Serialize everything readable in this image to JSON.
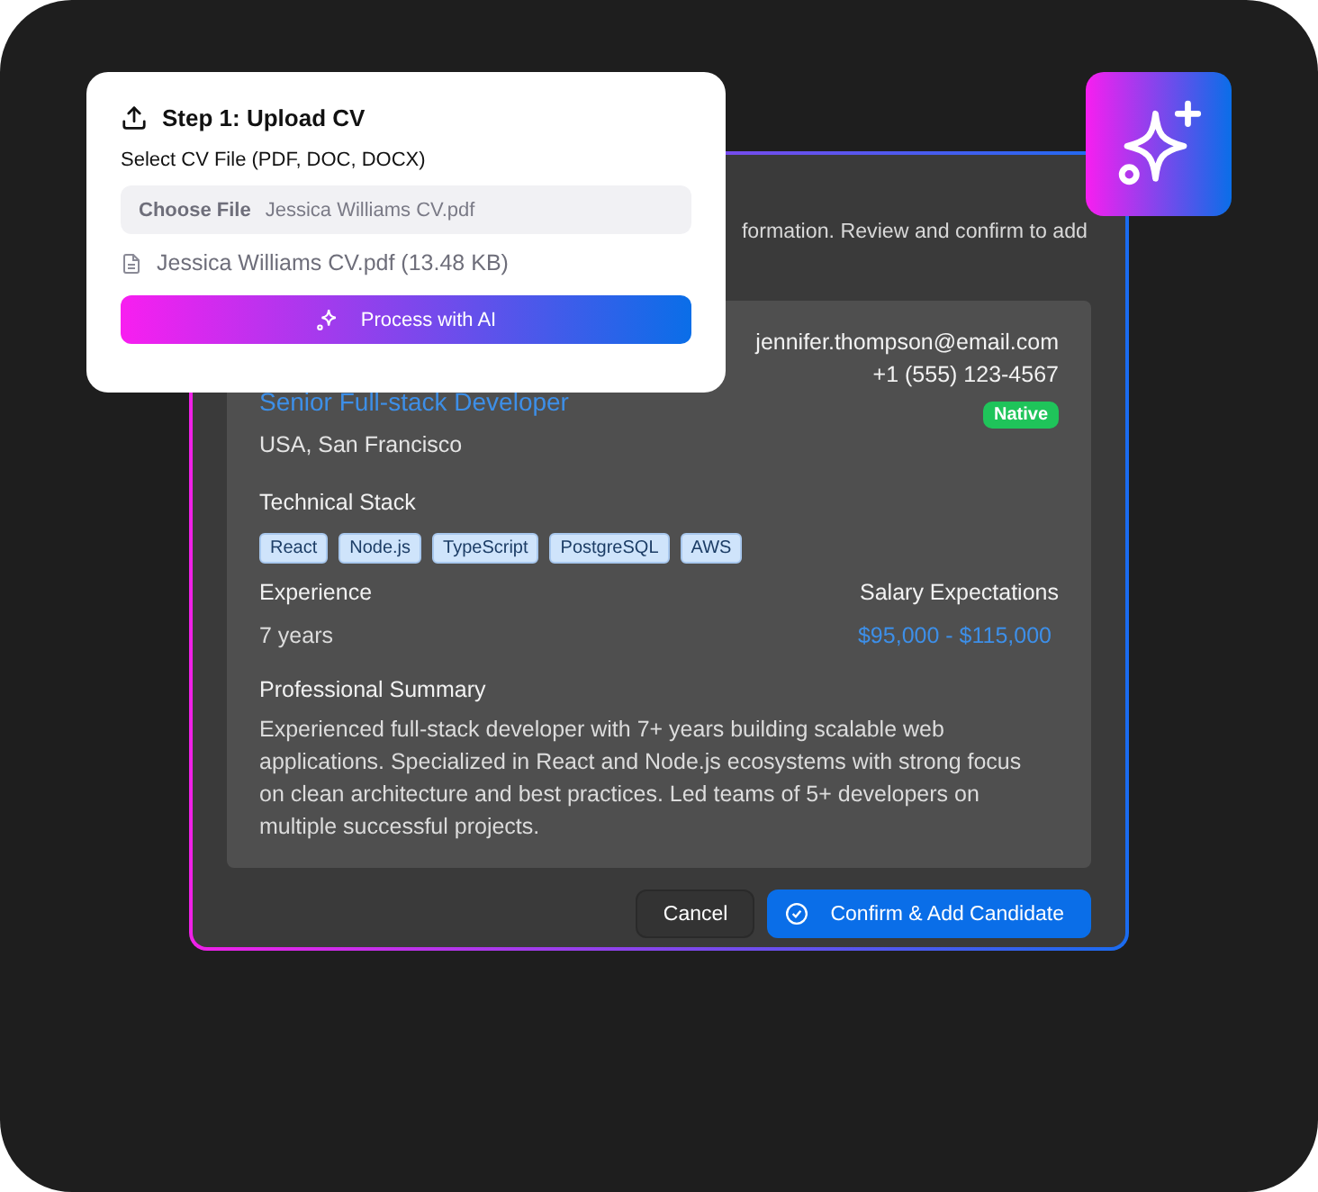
{
  "upload_panel": {
    "title": "Step 1: Upload CV",
    "field_label": "Select CV File (PDF, DOC, DOCX)",
    "choose_button": "Choose File",
    "file_value": "Jessica Williams CV.pdf",
    "file_info": "Jessica Williams CV.pdf (13.48 KB)",
    "process_button": "Process with AI"
  },
  "dialog": {
    "description": "formation. Review and confirm to add",
    "candidate": {
      "job_title": "Senior Full-stack Developer",
      "location": "USA, San Francisco",
      "email": "jennifer.thompson@email.com",
      "phone": "+1 (555) 123-4567",
      "language_badge": "Native",
      "stack_heading": "Technical Stack",
      "stack": [
        "React",
        "Node.js",
        "TypeScript",
        "PostgreSQL",
        "AWS"
      ],
      "experience_heading": "Experience",
      "experience": "7 years",
      "salary_heading": "Salary Expectations",
      "salary": "$95,000 - $115,000",
      "summary_heading": "Professional Summary",
      "summary": "Experienced full-stack developer with 7+ years building scalable web applications. Specialized in React and Node.js ecosystems with strong focus on clean architecture and best practices. Led teams of 5+ developers on multiple successful projects."
    },
    "buttons": [
      {
        "label": "Cancel",
        "kind": "secondary"
      },
      {
        "label": "Confirm & Add Candidate",
        "kind": "primary"
      }
    ]
  }
}
